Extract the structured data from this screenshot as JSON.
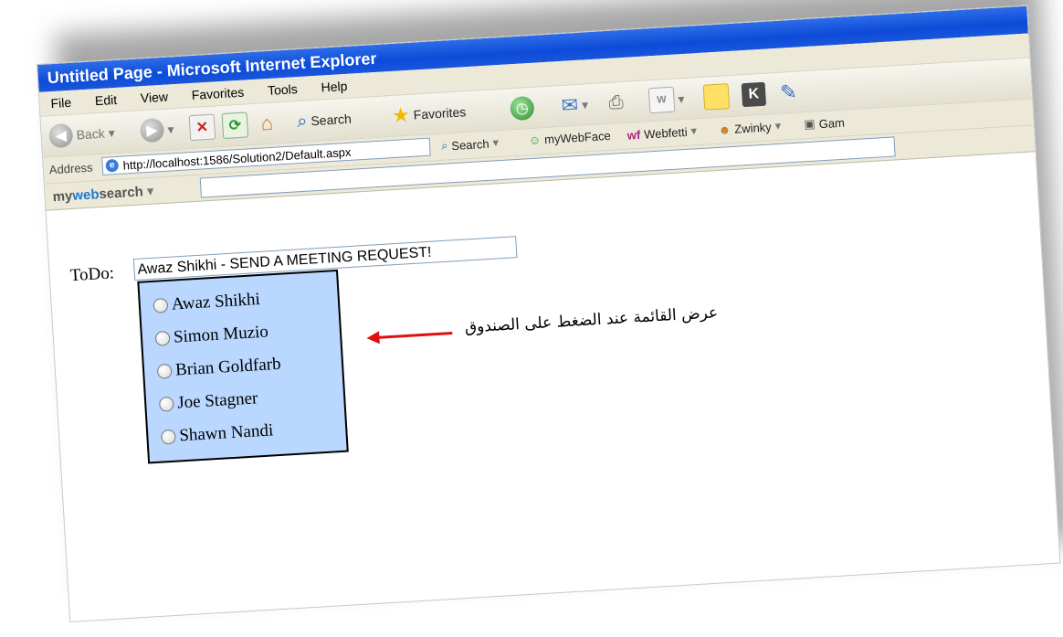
{
  "window": {
    "title": "Untitled Page - Microsoft Internet Explorer",
    "title_bar_color": "#0c4bd8"
  },
  "menu": {
    "items": [
      "File",
      "Edit",
      "View",
      "Favorites",
      "Tools",
      "Help"
    ]
  },
  "toolbar": {
    "back_label": "Back",
    "search_label": "Search",
    "favorites_label": "Favorites"
  },
  "address_bar": {
    "label": "Address",
    "url": "http://localhost:1586/Solution2/Default.aspx",
    "search_label": "Search",
    "mywebface_label": "myWebFace",
    "webfetti_label": "Webfetti",
    "zwinky_label": "Zwinky",
    "games_label": "Gam"
  },
  "mywebsearch": {
    "logo_my": "my",
    "logo_web": "web",
    "logo_search": "search"
  },
  "page": {
    "todo_label": "ToDo:",
    "todo_value": "Awaz Shikhi - SEND A MEETING REQUEST!",
    "options": [
      "Awaz Shikhi",
      "Simon Muzio",
      "Brian Goldfarb",
      "Joe Stagner",
      "Shawn Nandi"
    ],
    "dropdown_bg": "#b9d7ff"
  },
  "annotation": {
    "text": "عرض القائمة عند الضغط على الصندوق",
    "arrow_color": "#e01010"
  }
}
